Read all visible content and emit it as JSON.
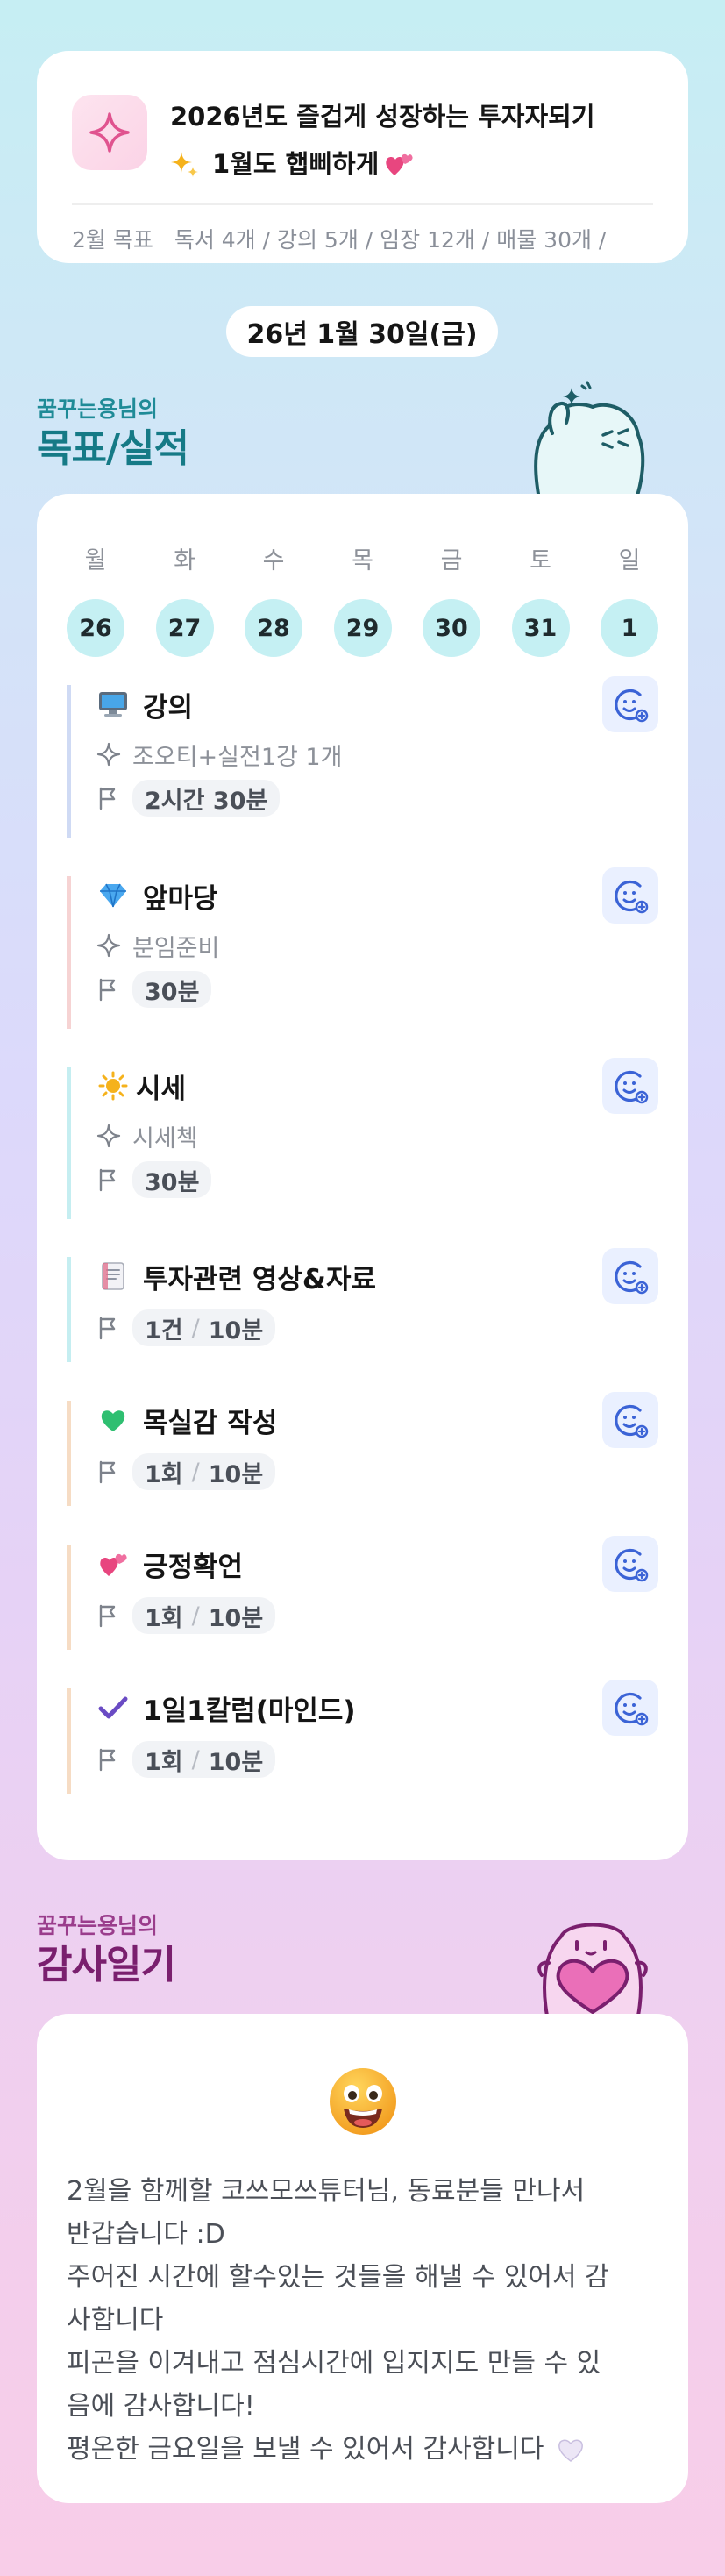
{
  "header": {
    "title_line1": "2026년도 즐겁게 성장하는 투자자되기",
    "title_line2": "1월도 햅삐하게",
    "goal_label": "2월 목표",
    "goal_text": "독서 4개 / 강의 5개 / 임장 12개 / 매물 30개 /"
  },
  "date": "26년 1월 30일(금)",
  "goals_section": {
    "subtitle": "꿈꾸는용님의",
    "title": "목표/실적"
  },
  "week": [
    {
      "day": "월",
      "date": "26"
    },
    {
      "day": "화",
      "date": "27"
    },
    {
      "day": "수",
      "date": "28"
    },
    {
      "day": "목",
      "date": "29"
    },
    {
      "day": "금",
      "date": "30"
    },
    {
      "day": "토",
      "date": "31"
    },
    {
      "day": "일",
      "date": "1"
    }
  ],
  "tasks": [
    {
      "emoji": "computer-icon",
      "title": "강의",
      "desc": "조오티+실전1강 1개",
      "chip_a": "2시간 30분",
      "chip_b": "",
      "color": "#cfdaf4"
    },
    {
      "emoji": "diamond-icon",
      "title": "앞마당",
      "desc": "분임준비",
      "chip_a": "30분",
      "chip_b": "",
      "color": "#f6d3d3"
    },
    {
      "emoji": "sun-icon",
      "title": "시세",
      "desc": "시세첵",
      "chip_a": "30분",
      "chip_b": "",
      "color": "#c5eef1"
    },
    {
      "emoji": "document-icon",
      "title": "투자관련 영상&자료",
      "desc": "",
      "chip_a": "1건",
      "chip_b": "10분",
      "color": "#c5eef1"
    },
    {
      "emoji": "green-heart-icon",
      "title": "목실감 작성",
      "desc": "",
      "chip_a": "1회",
      "chip_b": "10분",
      "color": "#f6dcc4"
    },
    {
      "emoji": "two-hearts-icon",
      "title": "긍정확언",
      "desc": "",
      "chip_a": "1회",
      "chip_b": "10분",
      "color": "#f6dcc4"
    },
    {
      "emoji": "check-icon",
      "title": "1일1칼럼(마인드)",
      "desc": "",
      "chip_a": "1회",
      "chip_b": "10분",
      "color": "#f6dcc4"
    }
  ],
  "thanks_section": {
    "subtitle": "꿈꾸는용님의",
    "title": "감사일기",
    "lines": [
      "2월을 함께할 코쓰모쓰튜터님, 동료분들 만나서",
      "반갑습니다 :D",
      "주어진 시간에 할수있는 것들을 해낼 수 있어서 감",
      "사합니다",
      "피곤을 이겨내고 점심시간에 입지지도 만들 수 있",
      "음에 감사합니다!",
      "평온한 금요일을 보낼 수 있어서 감사합니다"
    ]
  },
  "colors": {
    "accent_teal": "#157a86",
    "accent_purple": "#7a1f6e",
    "day_circle": "#c5f0f3",
    "icon_blue": "#3b63d6"
  }
}
